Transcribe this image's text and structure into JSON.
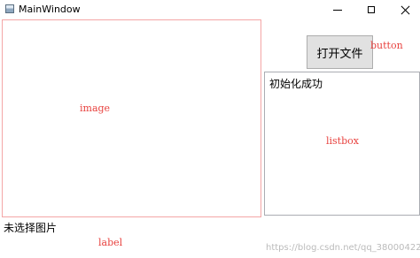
{
  "window": {
    "title": "MainWindow",
    "icon": "window-app-icon",
    "controls": [
      "minimize-icon",
      "maximize-icon",
      "close-icon"
    ]
  },
  "image_area": {
    "hint": "image",
    "border_color": "#f4a6a6"
  },
  "toolbar": {
    "open_file_label": "打开文件",
    "hint": "button"
  },
  "listbox": {
    "items": [
      "初始化成功"
    ],
    "hint": "listbox"
  },
  "status": {
    "label": "未选择图片",
    "hint": "label"
  },
  "watermark": {
    "text": "https://blog.csdn.net/qq_38000422"
  },
  "colors": {
    "hint_text": "#e8423f",
    "button_bg": "#e1e1e1"
  }
}
